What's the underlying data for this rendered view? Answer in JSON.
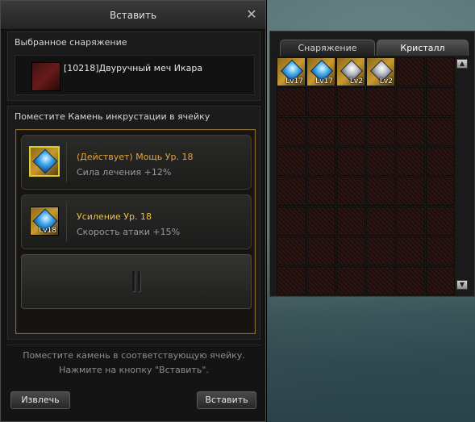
{
  "dialog": {
    "title": "Вставить",
    "close_icon": "close-icon",
    "selected_equipment": {
      "label": "Выбранное снаряжение",
      "item_name": "[10218]Двуручный меч Икара",
      "icon": "sword-icon"
    },
    "slots_section": {
      "label": "Поместите Камень инкрустации в ячейку",
      "slots": [
        {
          "title": "(Действует) Мощь Ур. 18",
          "effect": "Сила лечения +12%",
          "gem_level": "",
          "icon": "gem-icon"
        },
        {
          "title": "Усиление Ур. 18",
          "effect": "Скорость атаки +15%",
          "gem_level": "Lv18",
          "icon": "gem-icon"
        },
        {
          "title": "",
          "effect": "",
          "gem_level": "",
          "icon": "empty-slot-icon"
        }
      ]
    },
    "hint": {
      "line1": "Поместите камень в соответствующую ячейку.",
      "line2": "Нажмите на кнопку \"Вставить\"."
    },
    "buttons": {
      "extract": "Извлечь",
      "insert": "Вставить"
    }
  },
  "inventory": {
    "tabs": [
      {
        "label": "Снаряжение",
        "active": false
      },
      {
        "label": "Кристалл",
        "active": true
      }
    ],
    "items": [
      {
        "level": "Lv17",
        "stone": "blue"
      },
      {
        "level": "Lv17",
        "stone": "blue"
      },
      {
        "level": "Lv2",
        "stone": "silver"
      },
      {
        "level": "Lv2",
        "stone": "silver"
      }
    ],
    "rows": 8,
    "cols": 6
  }
}
